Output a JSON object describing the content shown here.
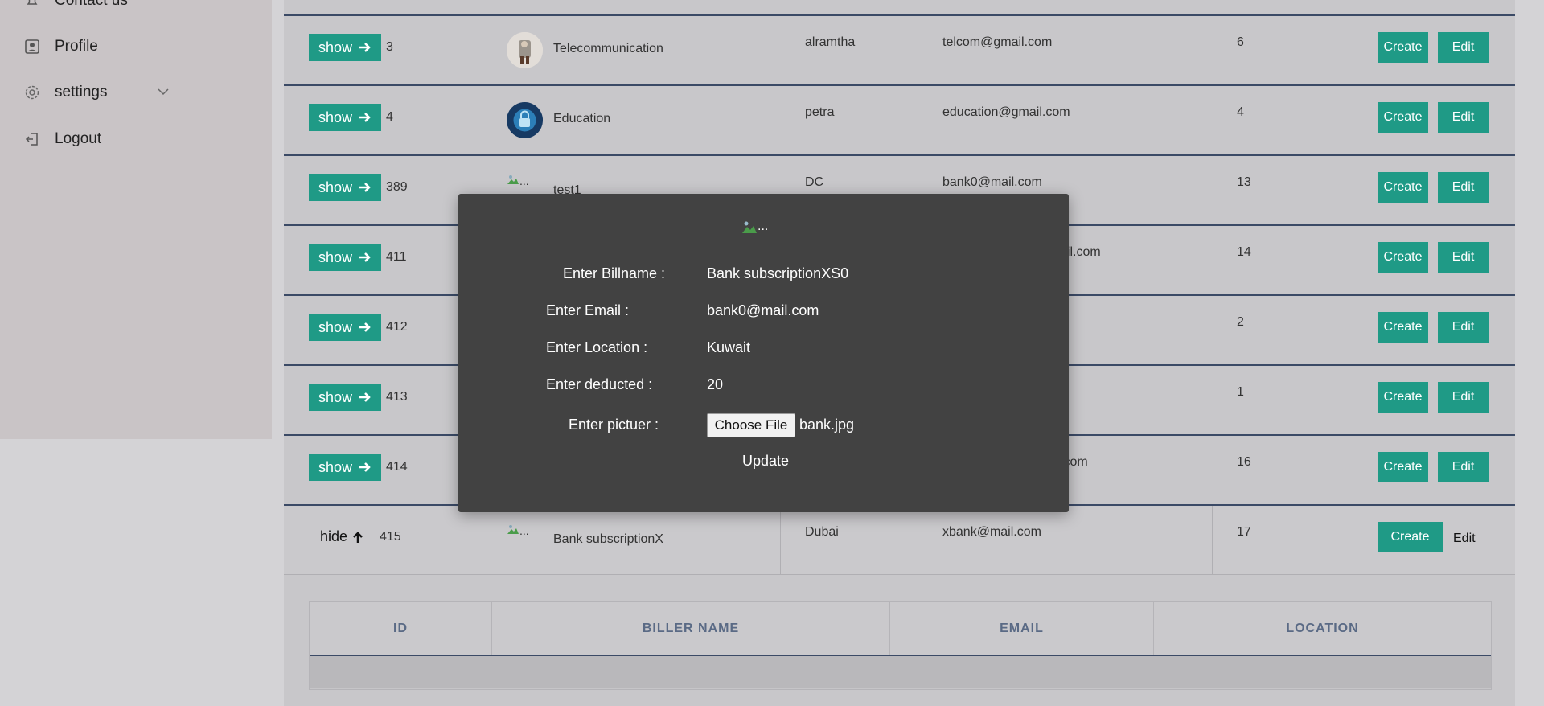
{
  "sidebar": {
    "contact_label": "Contact us",
    "profile_label": "Profile",
    "settings_label": "settings",
    "logout_label": "Logout"
  },
  "rows": [
    {
      "toggle": "show",
      "id": "3",
      "name": "Telecommunication",
      "user": "alramtha",
      "email": "telcom@gmail.com",
      "count": "6"
    },
    {
      "toggle": "show",
      "id": "4",
      "name": "Education",
      "user": "petra",
      "email": "education@gmail.com",
      "count": "4"
    },
    {
      "toggle": "show",
      "id": "389",
      "name": "test1",
      "user": "DC",
      "email": "bank0@mail.com",
      "count": "13"
    },
    {
      "toggle": "show",
      "id": "411",
      "name": "",
      "user": "",
      "email": "ail.com",
      "count": "14"
    },
    {
      "toggle": "show",
      "id": "412",
      "name": "",
      "user": "",
      "email": "",
      "count": "2"
    },
    {
      "toggle": "show",
      "id": "413",
      "name": "",
      "user": "",
      "email": "",
      "count": "1"
    },
    {
      "toggle": "show",
      "id": "414",
      "name": "",
      "user": "",
      "email": ".com",
      "count": "16"
    },
    {
      "toggle": "hide",
      "id": "415",
      "name": "Bank subscriptionX",
      "user": "Dubai",
      "email": "xbank@mail.com",
      "count": "17"
    }
  ],
  "actions": {
    "create": "Create",
    "edit": "Edit"
  },
  "broken_image_alt": "...",
  "subtable": {
    "headers": [
      "ID",
      "BILLER NAME",
      "EMAIL",
      "LOCATION"
    ]
  },
  "modal": {
    "header_alt": "...",
    "billname_label": "Enter Billname :",
    "billname_value": "Bank subscriptionXS0",
    "email_label": "Enter Email :",
    "email_value": "bank0@mail.com",
    "location_label": "Enter Location :",
    "location_value": "Kuwait",
    "deducted_label": "Enter deducted :",
    "deducted_value": "20",
    "picture_label": "Enter pictuer :",
    "file_button": "Choose File",
    "file_name": "bank.jpg",
    "update_label": "Update"
  },
  "colors": {
    "accent": "#1f9a86",
    "divider": "#3b4a66",
    "modal_bg": "#424242"
  }
}
